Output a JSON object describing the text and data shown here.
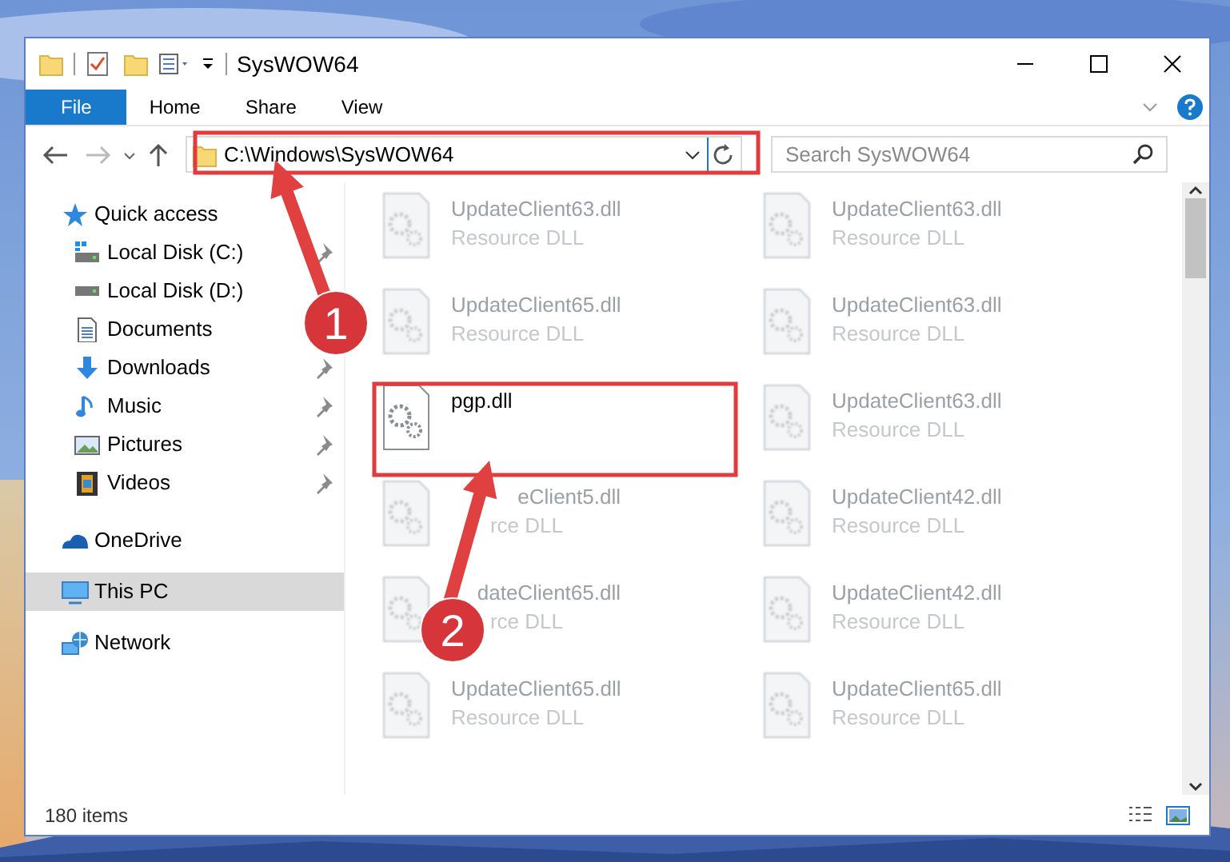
{
  "window": {
    "title": "SysWOW64"
  },
  "ribbon": {
    "tabs": [
      {
        "label": "File",
        "selected": true
      },
      {
        "label": "Home",
        "selected": false
      },
      {
        "label": "Share",
        "selected": false
      },
      {
        "label": "View",
        "selected": false
      }
    ]
  },
  "address_bar": {
    "path": "C:\\Windows\\SysWOW64"
  },
  "search": {
    "placeholder": "Search SysWOW64"
  },
  "sidebar": {
    "items": [
      {
        "label": "Quick access",
        "selected": false,
        "children": [
          {
            "label": "Local Disk (C:)",
            "pinned": true
          },
          {
            "label": "Local Disk (D:)",
            "pinned": false
          },
          {
            "label": "Documents",
            "pinned": false
          },
          {
            "label": "Downloads",
            "pinned": true
          },
          {
            "label": "Music",
            "pinned": true
          },
          {
            "label": "Pictures",
            "pinned": true
          },
          {
            "label": "Videos",
            "pinned": true
          }
        ]
      },
      {
        "label": "OneDrive",
        "selected": false
      },
      {
        "label": "This PC",
        "selected": true
      },
      {
        "label": "Network",
        "selected": false
      }
    ]
  },
  "files": [
    {
      "name": "UpdateClient63.dll",
      "type": "Resource DLL",
      "blurred": true
    },
    {
      "name": "UpdateClient63.dll",
      "type": "Resource DLL",
      "blurred": true
    },
    {
      "name": "UpdateClient65.dll",
      "type": "Resource DLL",
      "blurred": true
    },
    {
      "name": "UpdateClient63.dll",
      "type": "Resource DLL",
      "blurred": true
    },
    {
      "name": "pgp.dll",
      "blurred": false
    },
    {
      "name": "UpdateClient63.dll",
      "type": "Resource DLL",
      "blurred": true
    },
    {
      "name": "eClient5.dll",
      "type": "rce DLL",
      "blurred": true,
      "start_covered": true
    },
    {
      "name": "UpdateClient42.dll",
      "type": "Resource DLL",
      "blurred": true
    },
    {
      "name": "dateClient65.dll",
      "type": "rce DLL",
      "blurred": true,
      "start_covered": true
    },
    {
      "name": "UpdateClient42.dll",
      "type": "Resource DLL",
      "blurred": true
    },
    {
      "name": "UpdateClient65.dll",
      "type": "Resource DLL",
      "blurred": true
    },
    {
      "name": "UpdateClient65.dll",
      "type": "Resource DLL",
      "blurred": true
    }
  ],
  "status_bar": {
    "count": "180 items"
  },
  "annotations": [
    {
      "label": "1"
    },
    {
      "label": "2"
    }
  ]
}
